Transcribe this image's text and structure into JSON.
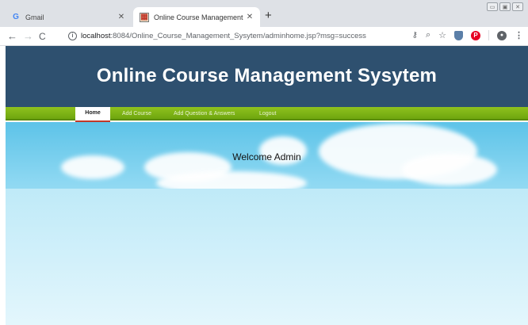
{
  "browser": {
    "tabs": [
      {
        "title": "Gmail",
        "favicon": "gmail-g-icon",
        "active": false
      },
      {
        "title": "Online Course Management Sys",
        "favicon": "page-favicon-icon",
        "active": true
      }
    ],
    "new_tab_symbol": "+",
    "url_host": "localhost",
    "url_path": ":8084/Online_Course_Management_Sysytem/adminhome.jsp?msg=success"
  },
  "site": {
    "title": "Online Course Management Sysytem",
    "header_color": "#2e506f",
    "nav_color": "#7fb317",
    "nav": {
      "home": "Home",
      "add_course": "Add Course",
      "add_qa": "Add Question & Answers",
      "logout": "Logout"
    },
    "welcome": "Welcome Admin"
  }
}
